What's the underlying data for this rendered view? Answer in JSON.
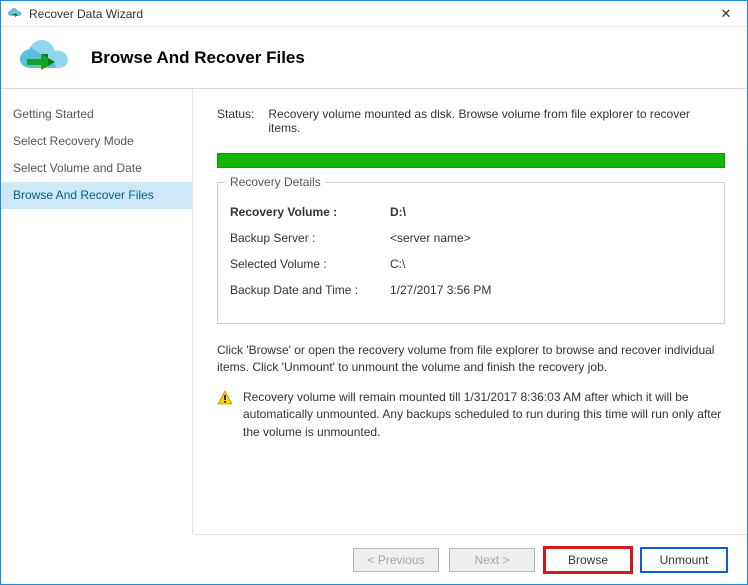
{
  "window": {
    "title": "Recover Data Wizard",
    "page_heading": "Browse And Recover Files"
  },
  "sidebar": {
    "items": [
      {
        "label": "Getting Started"
      },
      {
        "label": "Select Recovery Mode"
      },
      {
        "label": "Select Volume and Date"
      },
      {
        "label": "Browse And Recover Files"
      }
    ],
    "active_index": 3
  },
  "status": {
    "label": "Status:",
    "text": "Recovery volume mounted as disk. Browse volume from file explorer to recover items."
  },
  "details": {
    "group_title": "Recovery Details",
    "rows": [
      {
        "key": "Recovery Volume :",
        "value": "D:\\",
        "bold": true
      },
      {
        "key": "Backup Server :",
        "value": "<server name>"
      },
      {
        "key": "Selected Volume :",
        "value": "C:\\"
      },
      {
        "key": "Backup Date and Time :",
        "value": "1/27/2017 3:56 PM"
      }
    ]
  },
  "description": "Click 'Browse' or open the recovery volume from file explorer to browse and recover individual items. Click 'Unmount' to unmount the volume and finish the recovery job.",
  "warning": "Recovery volume will remain mounted till 1/31/2017 8:36:03 AM after which it will be automatically unmounted. Any backups scheduled to run during this time will run only after the volume is unmounted.",
  "buttons": {
    "previous": "< Previous",
    "next": "Next >",
    "browse": "Browse",
    "unmount": "Unmount"
  }
}
